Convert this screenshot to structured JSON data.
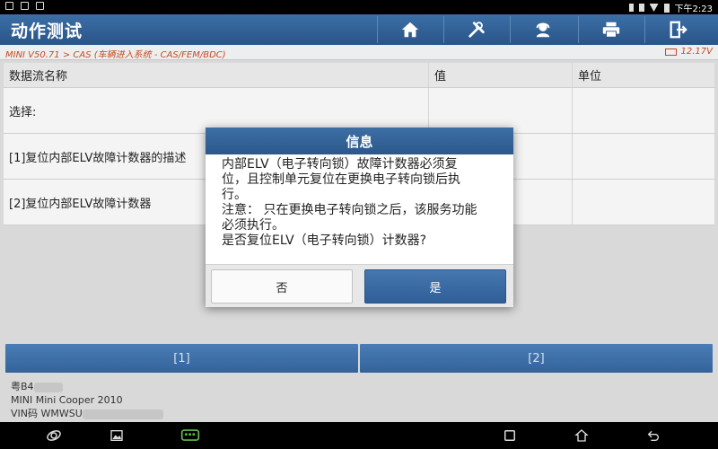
{
  "status_bar": {
    "time": "下午2:23"
  },
  "header": {
    "title": "动作测试",
    "toolbar": [
      {
        "icon": "home-icon"
      },
      {
        "icon": "tools-icon"
      },
      {
        "icon": "support-icon"
      },
      {
        "icon": "printer-icon"
      },
      {
        "icon": "exit-icon"
      }
    ]
  },
  "breadcrumb": {
    "path": "MINI V50.71 > CAS (车辆进入系统 - CAS/FEM/BDC)",
    "voltage": "12.17V"
  },
  "table": {
    "headers": [
      "数据流名称",
      "值",
      "单位"
    ],
    "rows": [
      {
        "name": "选择:",
        "value": "",
        "unit": ""
      },
      {
        "name": "[1]复位内部ELV故障计数器的描述",
        "value": "",
        "unit": ""
      },
      {
        "name": "[2]复位内部ELV故障计数器",
        "value": "",
        "unit": ""
      }
    ]
  },
  "buttons": [
    "[1]",
    "[2]"
  ],
  "vehicle": {
    "plate_prefix": "粤B4",
    "model": "MINI Mini Cooper 2010",
    "vin_label": "VIN码 WMWSU"
  },
  "dialog": {
    "title": "信息",
    "lines": [
      "内部ELV（电子转向锁）故障计数器必须复",
      "位，且控制单元复位在更换电子转向锁后执",
      "行。",
      "注意：  只在更换电子转向锁之后，该服务功能",
      "必须执行。",
      "是否复位ELV（电子转向锁）计数器?"
    ],
    "no_label": "否",
    "yes_label": "是"
  },
  "colors": {
    "accent": "#2f5f96",
    "crumb": "#c84a1f"
  }
}
